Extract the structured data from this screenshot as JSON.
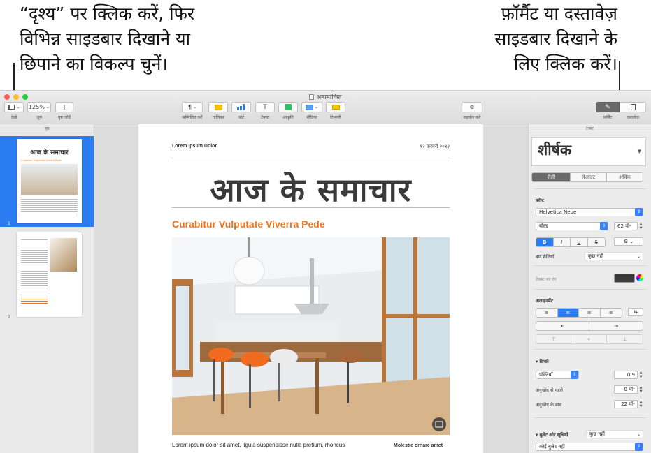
{
  "callouts": {
    "left_lines": [
      "“दृश्य” पर क्लिक करें, फिर",
      "विभिन्न साइडबार दिखाने या",
      "छिपाने का विकल्प चुनें।"
    ],
    "right_lines": [
      "फ़ॉर्मैट या दस्तावेज़",
      "साइडबार दिखाने के",
      "लिए क्लिक करें।"
    ]
  },
  "window": {
    "title": "अनामांकित",
    "traffic_colors": [
      "#fc5f57",
      "#fdbc2e",
      "#28c840"
    ]
  },
  "toolbar": {
    "view_label": "देखें",
    "zoom_value": "125%",
    "zoom_label": "ज़ूम",
    "add_page_label": "पृष्ठ जोड़ें",
    "insert_label": "सम्मिलित करें",
    "table_label": "तालिका",
    "chart_label": "चार्ट",
    "text_label": "टेक्स्ट",
    "shape_label": "आकृति",
    "media_label": "मीडिया",
    "comment_label": "टिप्पणी",
    "collaborate_label": "सहयोग करें",
    "format_label": "फ़ॉर्मैट",
    "document_label": "दस्तावेज़",
    "accent_colors": {
      "table": "#f5c400",
      "chart": "#2f7ae5",
      "shape": "#30c060",
      "comment": "#f4c400"
    }
  },
  "left_pane": {
    "header": "पृष्ठ",
    "pages": [
      {
        "number": "1",
        "title": "आज के समाचार",
        "subtitle": "Curabitur Vulputate Viverra Pede"
      },
      {
        "number": "2"
      }
    ]
  },
  "document": {
    "header_left": "Lorem Ipsum Dolor",
    "header_right": "१२ फ़रवरी २०१२",
    "title": "आज के समाचार",
    "subtitle": "Curabitur Vulputate Viverra Pede",
    "body": "Lorem ipsum dolor sit amet, ligula suspendisse nulla pretium, rhoncus",
    "side_heading": "Molestie ornare amet",
    "accent_color": "#f0731c"
  },
  "inspector": {
    "header": "टेक्स्ट",
    "paragraph_style": "शीर्षक",
    "tabs": [
      "शैली",
      "लेआउट",
      "अधिक"
    ],
    "font_section": "फ़ॉन्ट",
    "font_family": "Helvetica Neue",
    "font_weight": "बोल्ड",
    "font_size": "62 पॉ॰",
    "bold_glyph": "B",
    "italic_glyph": "I",
    "underline_glyph": "U",
    "strike_glyph": "S",
    "char_styles_label": "वर्ण शैलियाँ",
    "char_styles_value": "कुछ नहीं",
    "text_color_label": "टेक्स्ट का रंग",
    "text_color_value": "#3a3a3a",
    "alignment_section": "अलाइनमेंट",
    "spacing_section": "रिक्ति",
    "spacing_mode": "पंक्तियाँ",
    "spacing_value": "0.9",
    "before_label": "अनुच्छेद से पहले",
    "before_value": "0 पॉ॰",
    "after_label": "अनुच्छेद के बाद",
    "after_value": "22 पॉ॰",
    "bullets_section": "बुलेट और सूचियाँ",
    "bullets_value": "कुछ नहीं",
    "bullet_type": "कोई बुलेट नहीं"
  }
}
